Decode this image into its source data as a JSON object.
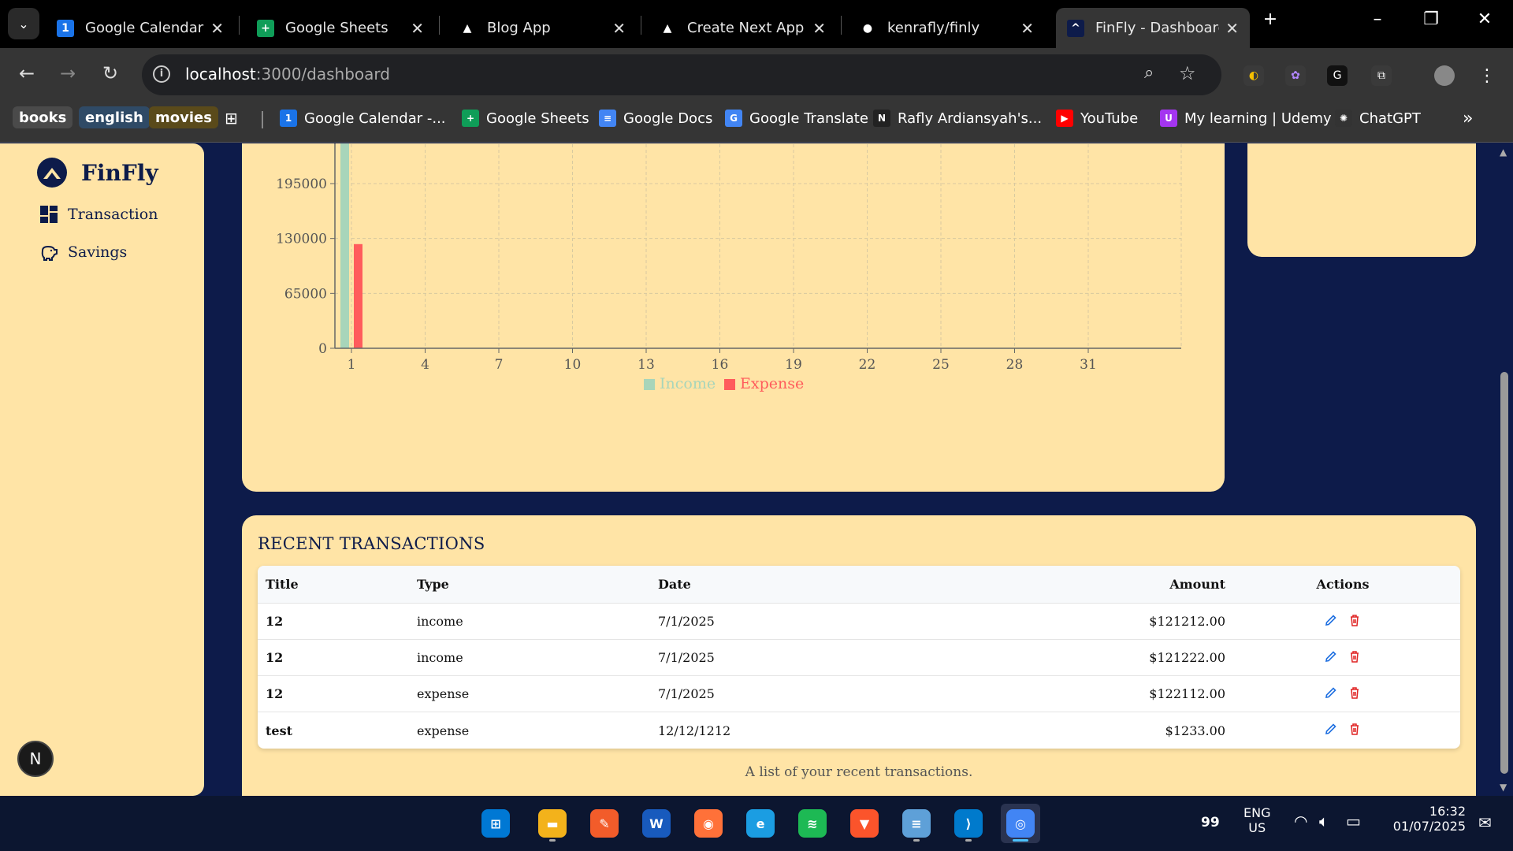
{
  "browser": {
    "tabs": [
      {
        "title": "Google Calendar -",
        "icon": "calendar-icon",
        "color": "#1a73e8",
        "glyph": "1",
        "active": false
      },
      {
        "title": "Google Sheets",
        "icon": "sheets-icon",
        "color": "#0f9d58",
        "glyph": "+",
        "active": false
      },
      {
        "title": "Blog App",
        "icon": "triangle-icon",
        "color": "#000000",
        "glyph": "▲",
        "active": false
      },
      {
        "title": "Create Next App",
        "icon": "triangle-icon",
        "color": "#000000",
        "glyph": "▲",
        "active": false
      },
      {
        "title": "kenrafly/finly",
        "icon": "github-icon",
        "color": "#000000",
        "glyph": "●",
        "active": false
      },
      {
        "title": "FinFly - Dashboard",
        "icon": "finfly-icon",
        "color": "#0d1b4a",
        "glyph": "^",
        "active": true
      }
    ],
    "url_host": "localhost",
    "url_path": ":3000/dashboard",
    "bookmarks_chips": [
      "books",
      "english",
      "movies"
    ],
    "bookmarks": [
      {
        "label": "Google Calendar -...",
        "icon": "calendar-icon",
        "color": "#1a73e8",
        "glyph": "1"
      },
      {
        "label": "Google Sheets",
        "icon": "sheets-icon",
        "color": "#0f9d58",
        "glyph": "+"
      },
      {
        "label": "Google Docs",
        "icon": "docs-icon",
        "color": "#4285f4",
        "glyph": "≡"
      },
      {
        "label": "Google Translate",
        "icon": "translate-icon",
        "color": "#4285f4",
        "glyph": "G"
      },
      {
        "label": "Rafly Ardiansyah's...",
        "icon": "notion-icon",
        "color": "#222222",
        "glyph": "N"
      },
      {
        "label": "YouTube",
        "icon": "youtube-icon",
        "color": "#ff0000",
        "glyph": "▶"
      },
      {
        "label": "My learning | Udemy",
        "icon": "udemy-icon",
        "color": "#a435f0",
        "glyph": "U"
      },
      {
        "label": "ChatGPT",
        "icon": "chatgpt-icon",
        "color": "#333333",
        "glyph": "✺"
      }
    ]
  },
  "app": {
    "brand": "FinFly",
    "nav": [
      {
        "label": "Transaction",
        "icon": "dashboard-icon"
      },
      {
        "label": "Savings",
        "icon": "piggy-bank-icon"
      }
    ],
    "avatar_letter": "N"
  },
  "chart_data": {
    "type": "bar",
    "x_ticks": [
      1,
      4,
      7,
      10,
      13,
      16,
      19,
      22,
      25,
      28,
      31
    ],
    "y_ticks": [
      0,
      65000,
      130000,
      195000
    ],
    "ylim": [
      0,
      195000
    ],
    "xlim": [
      1,
      31
    ],
    "grid": true,
    "legend_position": "bottom",
    "series": [
      {
        "name": "Income",
        "color": "#a8d5ba",
        "points": [
          {
            "x": 1,
            "y": 242434
          }
        ]
      },
      {
        "name": "Expense",
        "color": "#ff5c5c",
        "points": [
          {
            "x": 1,
            "y": 123345
          }
        ]
      }
    ]
  },
  "transactions": {
    "heading": "RECENT TRANSACTIONS",
    "columns": [
      "Title",
      "Type",
      "Date",
      "Amount",
      "Actions"
    ],
    "rows": [
      {
        "title": "12",
        "type": "income",
        "date": "7/1/2025",
        "amount": "$121212.00"
      },
      {
        "title": "12",
        "type": "income",
        "date": "7/1/2025",
        "amount": "$121222.00"
      },
      {
        "title": "12",
        "type": "expense",
        "date": "7/1/2025",
        "amount": "$122112.00"
      },
      {
        "title": "test",
        "type": "expense",
        "date": "12/12/1212",
        "amount": "$1233.00"
      }
    ],
    "caption": "A list of your recent transactions."
  },
  "taskbar": {
    "apps": [
      "start-icon",
      "file-explorer-icon",
      "brush-icon",
      "word-icon",
      "firefox-icon",
      "edge-icon",
      "spotify-icon",
      "brave-icon",
      "notepad-icon",
      "vscode-icon",
      "chrome-icon"
    ],
    "tray_number": "99",
    "lang_line1": "ENG",
    "lang_line2": "US",
    "time": "16:32",
    "date": "01/07/2025"
  }
}
